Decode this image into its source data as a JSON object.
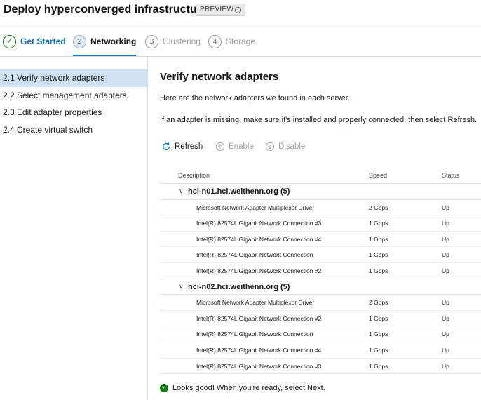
{
  "header": {
    "title": "Deploy hyperconverged infrastructure",
    "badge": "PREVIEW",
    "badge_icon": "ⓘ"
  },
  "steps": [
    {
      "number": "✓",
      "label": "Get Started",
      "state": "done"
    },
    {
      "number": "2",
      "label": "Networking",
      "state": "active"
    },
    {
      "number": "3",
      "label": "Clustering",
      "state": "upcoming"
    },
    {
      "number": "4",
      "label": "Storage",
      "state": "upcoming"
    }
  ],
  "sidebar": {
    "items": [
      {
        "num": "2.1",
        "label": "Verify network adapters",
        "selected": true
      },
      {
        "num": "2.2",
        "label": "Select management adapters",
        "selected": false
      },
      {
        "num": "2.3",
        "label": "Edit adapter properties",
        "selected": false
      },
      {
        "num": "2.4",
        "label": "Create virtual switch",
        "selected": false
      }
    ]
  },
  "main": {
    "title": "Verify network adapters",
    "description": "Here are the network adapters we found in each server.",
    "instruction": "If an adapter is missing, make sure it's installed and properly connected, then select Refresh."
  },
  "toolbar": {
    "refresh": "Refresh",
    "enable": "Enable",
    "disable": "Disable"
  },
  "table": {
    "columns": [
      "Description",
      "Speed",
      "Status"
    ],
    "groups": [
      {
        "name": "hci-n01.hci.weithenn.org (5)",
        "rows": [
          [
            "Microsoft Network Adapter Multiplexor Driver",
            "2 Gbps",
            "Up"
          ],
          [
            "Intel(R) 82574L Gigabit Network Connection #3",
            "1 Gbps",
            "Up"
          ],
          [
            "Intel(R) 82574L Gigabit Network Connection #4",
            "1 Gbps",
            "Up"
          ],
          [
            "Intel(R) 82574L Gigabit Network Connection",
            "1 Gbps",
            "Up"
          ],
          [
            "Intel(R) 82574L Gigabit Network Connection #2",
            "1 Gbps",
            "Up"
          ]
        ]
      },
      {
        "name": "hci-n02.hci.weithenn.org (5)",
        "rows": [
          [
            "Microsoft Network Adapter Multiplexor Driver",
            "2 Gbps",
            "Up"
          ],
          [
            "Intel(R) 82574L Gigabit Network Connection #2",
            "1 Gbps",
            "Up"
          ],
          [
            "Intel(R) 82574L Gigabit Network Connection",
            "1 Gbps",
            "Up"
          ],
          [
            "Intel(R) 82574L Gigabit Network Connection #4",
            "1 Gbps",
            "Up"
          ],
          [
            "Intel(R) 82574L Gigabit Network Connection #3",
            "1 Gbps",
            "Up"
          ]
        ]
      }
    ]
  },
  "status": {
    "message": "Looks good! When you're ready, select Next."
  },
  "colors": {
    "accent": "#0078d4",
    "success": "#107c10",
    "selected_bg": "#cde1f2"
  }
}
